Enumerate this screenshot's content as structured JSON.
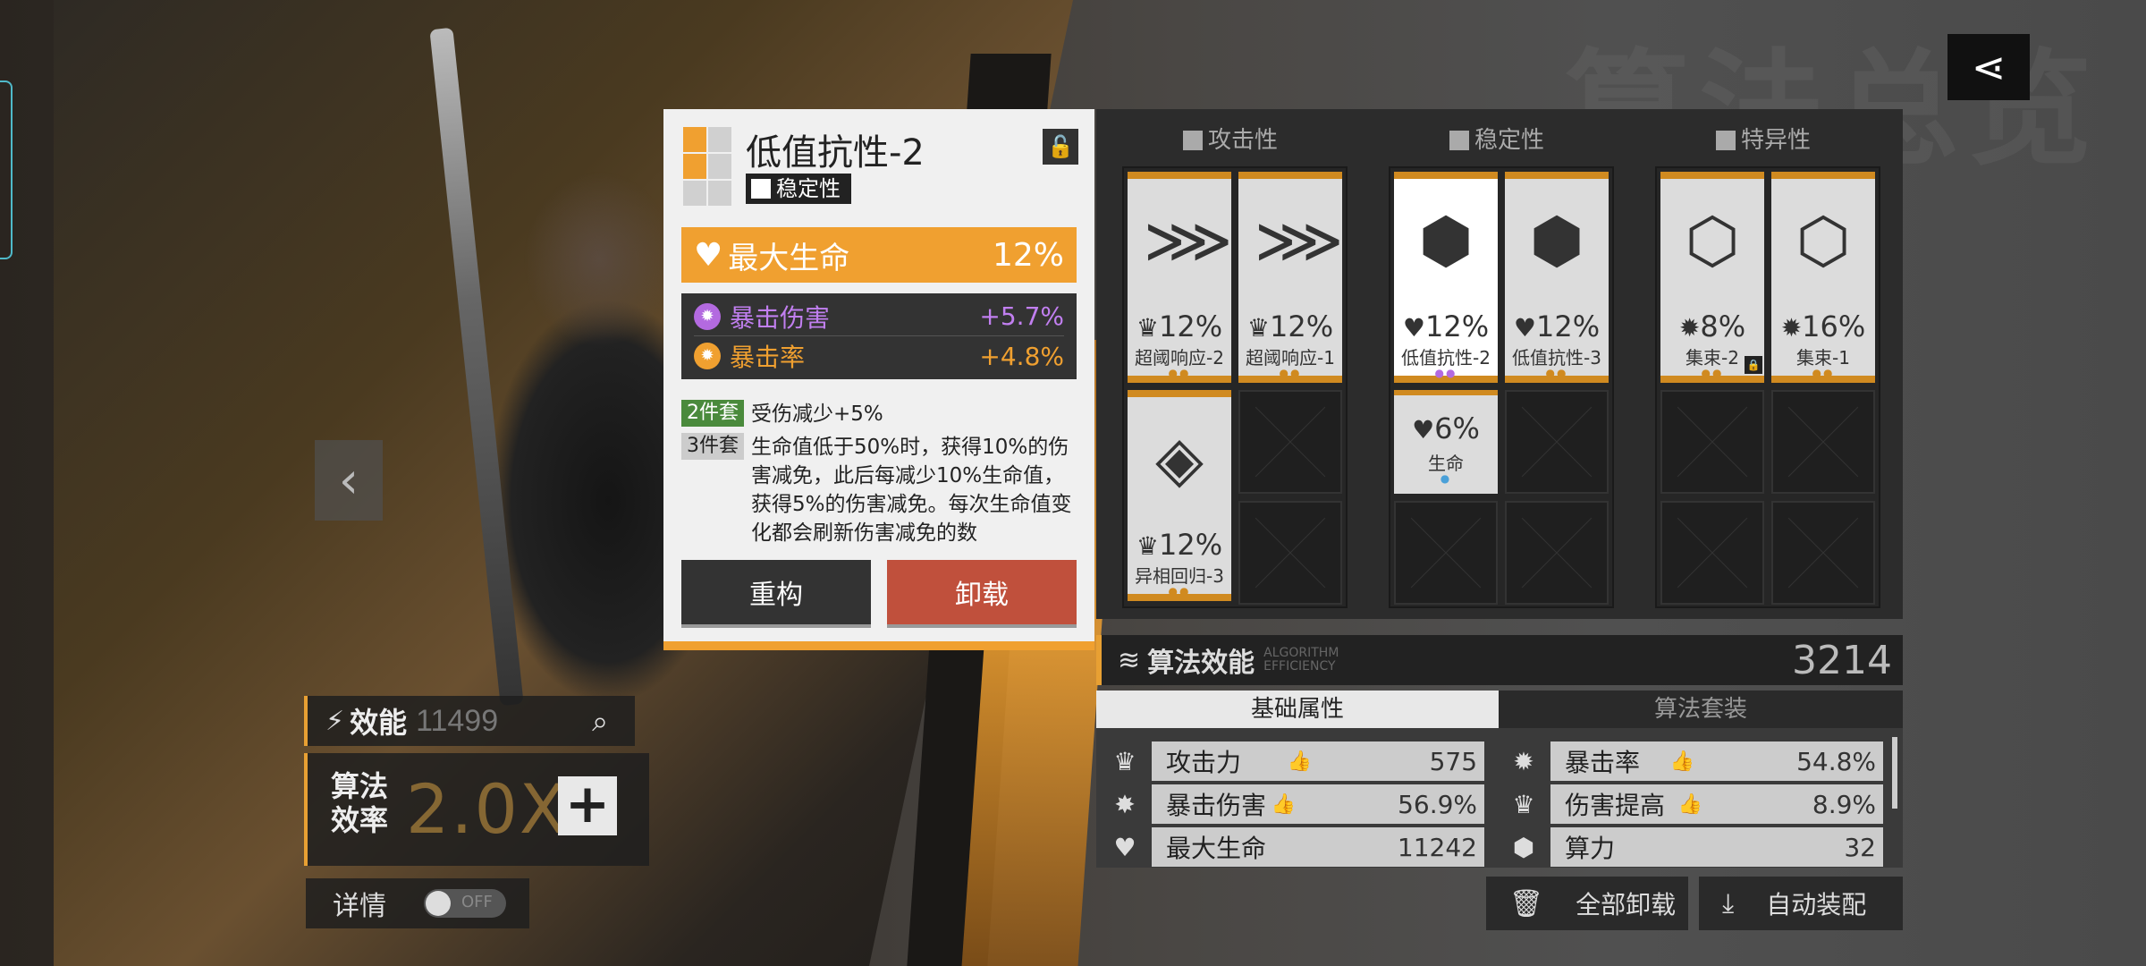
{
  "watermark": "算法总览",
  "nav": {
    "prev_icon": "chevron-left-icon",
    "prev_glyph": "‹"
  },
  "left": {
    "efficiency_label": "效能",
    "efficiency_value": "11499",
    "rate_label": "算法效率",
    "rate_value": "2.0X",
    "plus_label": "+",
    "details_label": "详情",
    "toggle_state": "OFF"
  },
  "card": {
    "title": "低值抗性-2",
    "type": "稳定性",
    "main_stat": {
      "name": "最大生命",
      "value": "12%"
    },
    "sub_stats": [
      {
        "name": "暴击伤害",
        "value": "+5.7%",
        "color": "#b36ae0"
      },
      {
        "name": "暴击率",
        "value": "+4.8%",
        "color": "#f0a030"
      }
    ],
    "set2": {
      "tag": "2件套",
      "text": "受伤减少+5%"
    },
    "set3": {
      "tag": "3件套",
      "text": "生命值低于50%时，获得10%的伤害减免，此后每减少10%生命值，获得5%的伤害减免。每次生命值变化都会刷新伤害减免的数"
    },
    "rebuild_label": "重构",
    "unequip_label": "卸载"
  },
  "panel": {
    "columns": [
      "攻击性",
      "稳定性",
      "特异性"
    ],
    "slots": {
      "atk1": {
        "value": "12%",
        "name": "超阈响应-2",
        "dots": "●●"
      },
      "atk2": {
        "value": "12%",
        "name": "超阈响应-1",
        "dots": "●●"
      },
      "atk3": {
        "value": "12%",
        "name": "异相回归-3",
        "dots": "●●"
      },
      "stb1": {
        "value": "12%",
        "name": "低值抗性-2",
        "dots": "●●"
      },
      "stb2": {
        "value": "12%",
        "name": "低值抗性-3",
        "dots": "●●"
      },
      "stb3": {
        "value": "6%",
        "name": "生命",
        "dots": "●"
      },
      "spc1": {
        "value": "8%",
        "name": "集束-2",
        "dots": "●●"
      },
      "spc2": {
        "value": "16%",
        "name": "集束-1",
        "dots": "●●"
      }
    }
  },
  "algo": {
    "label": "算法效能",
    "en": "ALGORITHM EFFICIENCY",
    "value": "3214"
  },
  "attrs": {
    "tab_basic": "基础属性",
    "tab_sets": "算法套装",
    "rows": [
      {
        "name": "攻击力",
        "value": "575"
      },
      {
        "name": "暴击率",
        "value": "54.8%"
      },
      {
        "name": "暴击伤害",
        "value": "56.9%"
      },
      {
        "name": "伤害提高",
        "value": "8.9%"
      },
      {
        "name": "最大生命",
        "value": "11242"
      },
      {
        "name": "算力",
        "value": "32"
      }
    ]
  },
  "buttons": {
    "unequip_all": "全部卸载",
    "auto_equip": "自动装配"
  },
  "colors": {
    "accent": "#f0a030",
    "danger": "#c0503c",
    "dark": "#333333"
  }
}
